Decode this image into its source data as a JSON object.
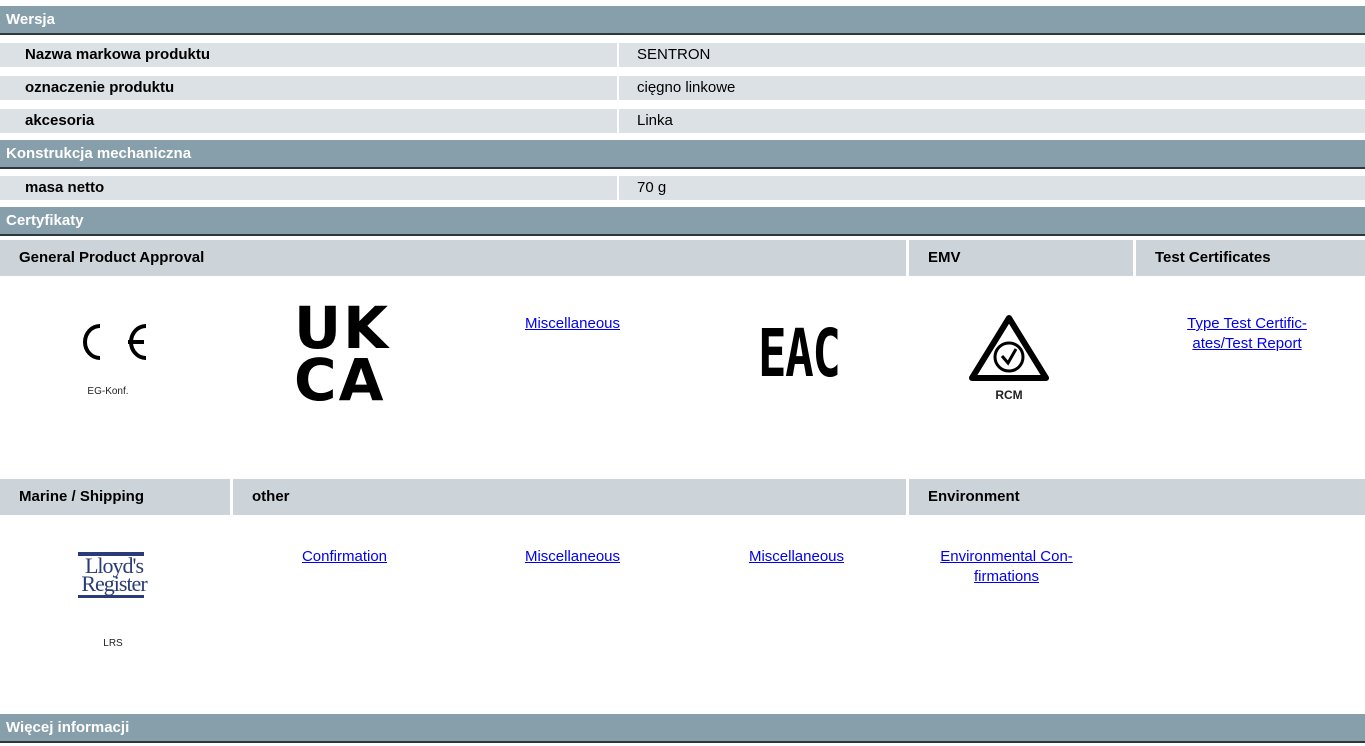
{
  "sections": {
    "version": "Wersja",
    "mechanical": "Konstrukcja mechaniczna",
    "certificates": "Certyfikaty",
    "more_info": "Więcej informacji"
  },
  "version_rows": [
    {
      "label": "Nazwa markowa produktu",
      "value": "SENTRON"
    },
    {
      "label": "oznaczenie produktu",
      "value": "cięgno linkowe"
    },
    {
      "label": "akcesoria",
      "value": "Linka"
    }
  ],
  "mechanical_rows": [
    {
      "label": "masa netto",
      "value": "70 g"
    }
  ],
  "cert_headers_1": {
    "general": "General Product Approval",
    "emv": "EMV",
    "test": "Test Certificates"
  },
  "cert_row_1": {
    "ce_caption": "EG-Konf.",
    "ukca_line1": "UK",
    "ukca_line2": "CA",
    "misc_link": "Miscellaneous",
    "eac_text": "EAC",
    "rcm_caption": "RCM",
    "type_test_link_line1": "Type Test Certific-",
    "type_test_link_line2": "ates/Test Report"
  },
  "cert_headers_2": {
    "marine": "Marine / Shipping",
    "other": "other",
    "environment": "Environment"
  },
  "cert_row_2": {
    "lloyds_line1": "Lloyd's",
    "lloyds_line2": "Register",
    "lrs_caption": "LRS",
    "confirmation_link": "Confirmation",
    "misc_link_1": "Miscellaneous",
    "misc_link_2": "Miscellaneous",
    "env_link_line1": "Environmental Con-",
    "env_link_line2": "firmations"
  }
}
